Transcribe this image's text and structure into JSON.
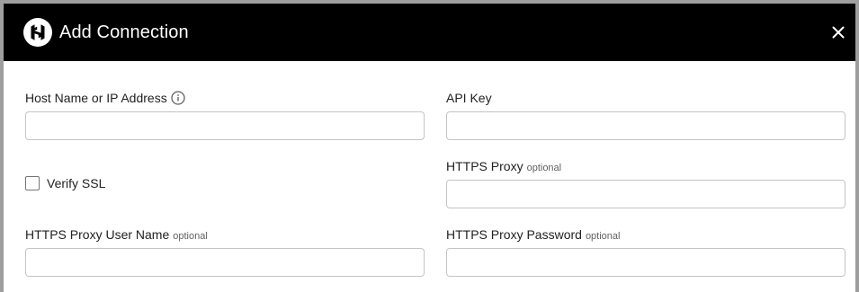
{
  "dialog": {
    "title": "Add Connection",
    "logo_icon": "hashicorp-logo-icon",
    "close_icon": "close-icon"
  },
  "form": {
    "host": {
      "label": "Host Name or IP Address",
      "info_icon": "info-icon",
      "value": "",
      "placeholder": ""
    },
    "api_key": {
      "label": "API Key",
      "value": "",
      "placeholder": ""
    },
    "verify_ssl": {
      "label": "Verify SSL",
      "checked": false
    },
    "https_proxy": {
      "label": "HTTPS Proxy",
      "optional": "optional",
      "value": "",
      "placeholder": ""
    },
    "proxy_user": {
      "label": "HTTPS Proxy User Name",
      "optional": "optional",
      "value": "",
      "placeholder": ""
    },
    "proxy_password": {
      "label": "HTTPS Proxy Password",
      "optional": "optional",
      "value": "",
      "placeholder": ""
    }
  },
  "colors": {
    "header_bg": "#000000",
    "header_text": "#ffffff",
    "frame_border": "#9e9e9e",
    "input_border": "#c4c4c4"
  }
}
